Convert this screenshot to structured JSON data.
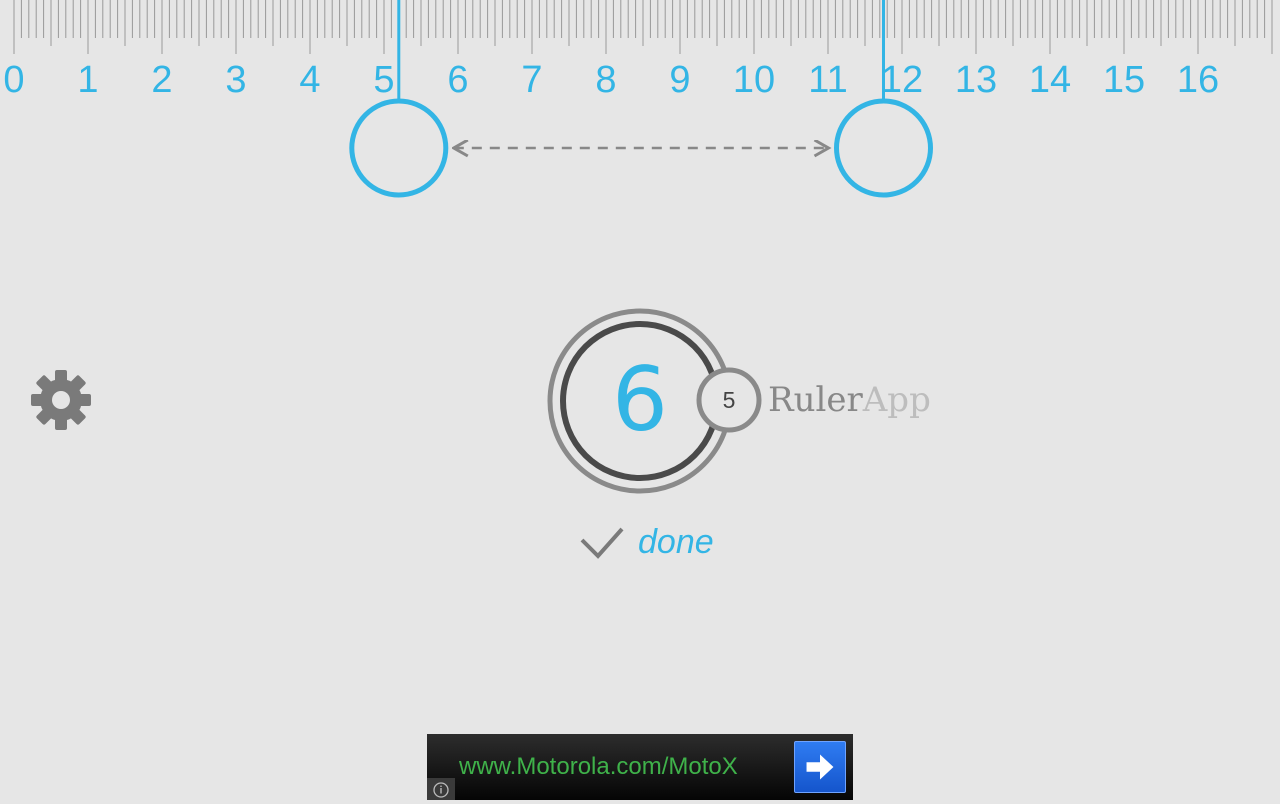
{
  "ruler": {
    "labels": [
      "0",
      "1",
      "2",
      "3",
      "4",
      "5",
      "6",
      "7",
      "8",
      "9",
      "10",
      "11",
      "12",
      "13",
      "14",
      "15",
      "16"
    ]
  },
  "measurement": {
    "start": 5.2,
    "end": 11.75
  },
  "dial": {
    "value": "6",
    "secondary_value": "5"
  },
  "brand": {
    "ruler": "Ruler",
    "app": "App"
  },
  "done": {
    "label": "done"
  },
  "ad": {
    "text": "www.Motorola.com/MotoX"
  },
  "colors": {
    "accent": "#33b5e5",
    "icon_gray": "#7a7a7a",
    "background": "#e6e6e6",
    "ad_text": "#3fb24a",
    "ad_button": "#2a6ee8"
  },
  "icons": {
    "settings": "gear-icon",
    "done": "checkmark-icon",
    "ad_go": "arrow-right-icon",
    "ad_info": "info-icon"
  }
}
